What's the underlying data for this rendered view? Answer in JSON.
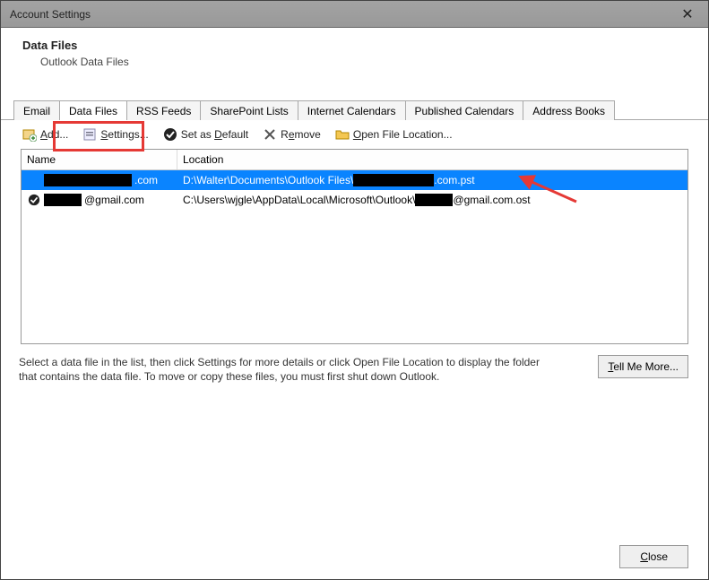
{
  "window": {
    "title": "Account Settings"
  },
  "header": {
    "title": "Data Files",
    "subtitle": "Outlook Data Files"
  },
  "tabs": [
    {
      "label": "Email"
    },
    {
      "label": "Data Files"
    },
    {
      "label": "RSS Feeds"
    },
    {
      "label": "SharePoint Lists"
    },
    {
      "label": "Internet Calendars"
    },
    {
      "label": "Published Calendars"
    },
    {
      "label": "Address Books"
    }
  ],
  "active_tab_index": 1,
  "toolbar": {
    "add": "Add...",
    "settings": "Settings...",
    "set_default": "Set as Default",
    "remove": "Remove",
    "open_location": "Open File Location..."
  },
  "columns": {
    "name": "Name",
    "location": "Location"
  },
  "rows": [
    {
      "selected": true,
      "is_default": false,
      "name_suffix": ".com",
      "loc_prefix": "D:\\Walter\\Documents\\Outlook Files\\",
      "loc_suffix": ".com.pst"
    },
    {
      "selected": false,
      "is_default": true,
      "name_suffix": "@gmail.com",
      "loc_prefix": "C:\\Users\\wjgle\\AppData\\Local\\Microsoft\\Outlook\\",
      "loc_suffix": "@gmail.com.ost"
    }
  ],
  "instruction": "Select a data file in the list, then click Settings for more details or click Open File Location to display the folder that contains the data file. To move or copy these files, you must first shut down Outlook.",
  "tell_more": "Tell Me More...",
  "close_label": "Close"
}
